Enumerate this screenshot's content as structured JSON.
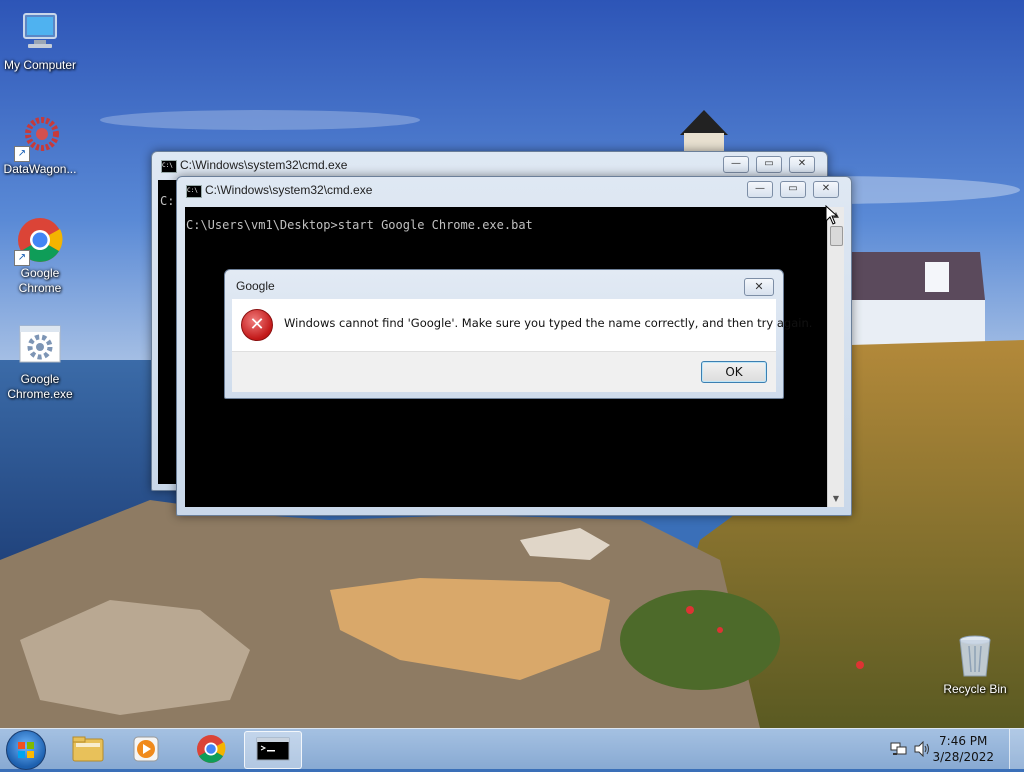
{
  "desktop": {
    "icons": [
      {
        "label": "My Computer",
        "icon": "computer-icon"
      },
      {
        "label": "DataWagon...",
        "icon": "datawagon-icon"
      },
      {
        "label": "Google Chrome",
        "icon": "chrome-icon"
      },
      {
        "label": "Google Chrome.exe",
        "icon": "gear-exe-icon"
      },
      {
        "label": "Recycle Bin",
        "icon": "recycle-bin-icon"
      }
    ]
  },
  "cmd_back": {
    "title": "C:\\Windows\\system32\\cmd.exe",
    "console_text": "C:"
  },
  "cmd_front": {
    "title": "C:\\Windows\\system32\\cmd.exe",
    "console_text": "C:\\Users\\vm1\\Desktop>start Google Chrome.exe.bat"
  },
  "window_controls": {
    "minimize": "—",
    "maximize": "▭",
    "close": "✕"
  },
  "dialog": {
    "title": "Google",
    "message": "Windows cannot find 'Google'. Make sure you typed the name correctly, and then try again.",
    "ok_label": "OK",
    "close_glyph": "✕",
    "error_glyph": "✕"
  },
  "taskbar": {
    "apps": [
      {
        "name": "file-explorer",
        "icon": "folder-icon"
      },
      {
        "name": "media-player",
        "icon": "media-player-icon"
      },
      {
        "name": "google-chrome",
        "icon": "chrome-icon"
      },
      {
        "name": "command-prompt",
        "icon": "cmd-icon"
      }
    ],
    "clock_time": "7:46 PM",
    "clock_date": "3/28/2022"
  }
}
